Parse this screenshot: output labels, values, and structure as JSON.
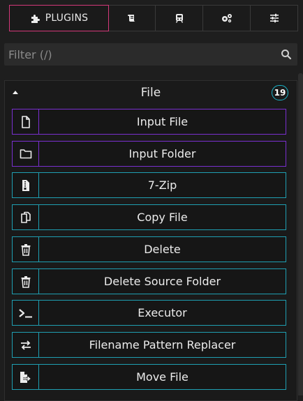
{
  "tabs": {
    "plugins_label": "PLUGINS",
    "icons": [
      "scroll-icon",
      "train-icon",
      "gears-icon",
      "sliders-icon"
    ]
  },
  "filter": {
    "placeholder": "Filter (/)"
  },
  "section": {
    "title": "File",
    "count": "19"
  },
  "items": [
    {
      "label": "Input File",
      "icon": "file-outline-icon",
      "color": "#7a2fd0"
    },
    {
      "label": "Input Folder",
      "icon": "folder-outline-icon",
      "color": "#7a2fd0"
    },
    {
      "label": "7-Zip",
      "icon": "zip-file-icon",
      "color": "#1f9fb2"
    },
    {
      "label": "Copy File",
      "icon": "copy-icon",
      "color": "#1f9fb2"
    },
    {
      "label": "Delete",
      "icon": "trash-icon",
      "color": "#1f9fb2"
    },
    {
      "label": "Delete Source Folder",
      "icon": "trash-icon",
      "color": "#1f9fb2"
    },
    {
      "label": "Executor",
      "icon": "terminal-icon",
      "color": "#1f9fb2"
    },
    {
      "label": "Filename Pattern Replacer",
      "icon": "swap-arrows-icon",
      "color": "#1f9fb2"
    },
    {
      "label": "Move File",
      "icon": "file-export-icon",
      "color": "#1f9fb2"
    }
  ],
  "colors": {
    "accent_active_tab": "#d4387a",
    "badge": "#19b4c9"
  }
}
